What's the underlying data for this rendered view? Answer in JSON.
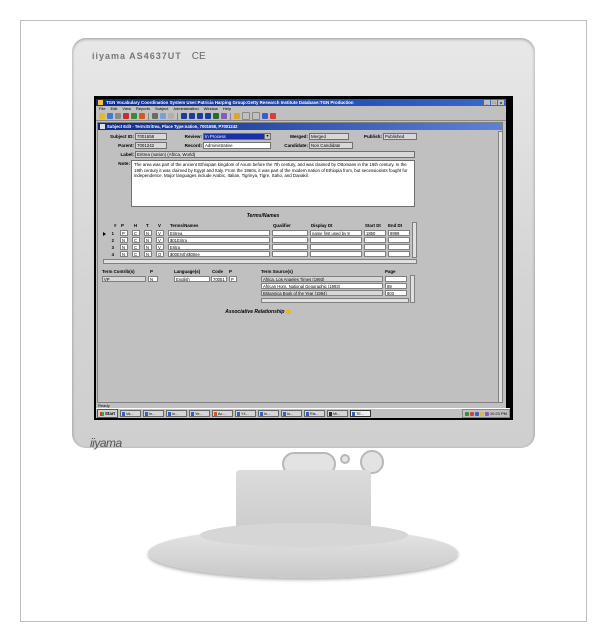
{
  "monitor": {
    "bezel_brand": "iiyama AS4637UT",
    "bezel_cert": "CE",
    "logo": "iiyama"
  },
  "app": {
    "title": "TGN Vocabulary Coordination System  User:Patricia Harping  Group:Getty Research Institute  Database:TGN Production",
    "window_buttons": [
      "_",
      "□",
      "x"
    ],
    "menu": [
      "File",
      "Edit",
      "View",
      "Reports",
      "Subject",
      "Administration",
      "Window",
      "Help"
    ],
    "child_title": "Subject Edit - Term:Eritrea, Place Type:nation, 7001658, P7001242",
    "subject": {
      "subject_id_label": "Subject ID:",
      "subject_id": "7001658",
      "review_label": "Review:",
      "review": "In Process",
      "merged_label": "Merged:",
      "merged": "Merged",
      "publish_label": "Publish:",
      "publish": "Published",
      "parent_label": "Parent:",
      "parent": "7001242",
      "record_label": "Record:",
      "record": "Administrative",
      "candidate_label": "Candidate:",
      "candidate": "Non Candidate",
      "label_label": "Label:",
      "label": "Eritrea (nation)  (Africa, World)",
      "note_label": "Note:",
      "note": "The area was part of the ancient Ethiopian kingdom of Axum before the 7th century, and was claimed by Ottomans in the 16th century. In the 19th century it was claimed by Egypt and Italy. From the 1960s, it was part of the modern nation of Ethiopia from, but secessionists fought for independence. Major languages include Arabic, Italian, Tigrinya, Tigre, Saho, and Danakil."
    },
    "terms": {
      "section_title": "Terms/Names",
      "headers": [
        "#",
        "P",
        "H",
        "T",
        "V",
        "Terms/Names",
        "Qualifier",
        "Display Dt",
        "Start Dt",
        "End Dt"
      ],
      "rows": [
        {
          "num": "1",
          "p": "P",
          "h": "C",
          "t": "N",
          "v": "V",
          "term": "Eritrea",
          "qualifier": "",
          "display": "name first used by 8",
          "start": "1850",
          "end": "9999"
        },
        {
          "num": "2",
          "p": "N",
          "h": "C",
          "t": "N",
          "v": "V",
          "term": "$01Eritra",
          "qualifier": "",
          "display": "",
          "start": "",
          "end": ""
        },
        {
          "num": "3",
          "p": "N",
          "h": "C",
          "t": "N",
          "v": "V",
          "term": "Eritra",
          "qualifier": "",
          "display": "",
          "start": "",
          "end": ""
        },
        {
          "num": "4",
          "p": "N",
          "h": "C",
          "t": "N",
          "v": "O",
          "term": "$00Erythr$00ee",
          "qualifier": "",
          "display": "",
          "start": "",
          "end": ""
        }
      ]
    },
    "contrib": {
      "headers": [
        "Term Contrib(s)",
        "P"
      ],
      "row": {
        "name": "VP",
        "p": "N"
      }
    },
    "language": {
      "headers": [
        "Language(s)",
        "Code",
        "P"
      ],
      "row": {
        "name": "English",
        "code": "70051",
        "p": "P"
      }
    },
    "sources": {
      "headers": [
        "Term Source(s)",
        "Page"
      ],
      "rows": [
        {
          "source": "Africa, Los Angeles Times (1993)",
          "page": ""
        },
        {
          "source": "African Horn, National Geographic (1993)",
          "page": "88"
        },
        {
          "source": "Britannica Book of the Year (1994)",
          "page": "603"
        }
      ]
    },
    "assoc_title": "Associative Relationship",
    "status": "Ready",
    "taskbar": {
      "start": "Start",
      "tasks": [
        "Va...",
        "In...",
        "In...",
        "Ye...",
        "Ac...",
        "Y4...",
        "In...",
        "In...",
        "Ris...",
        "Mi...",
        "TE..."
      ],
      "clock": "10:23 PM"
    }
  }
}
